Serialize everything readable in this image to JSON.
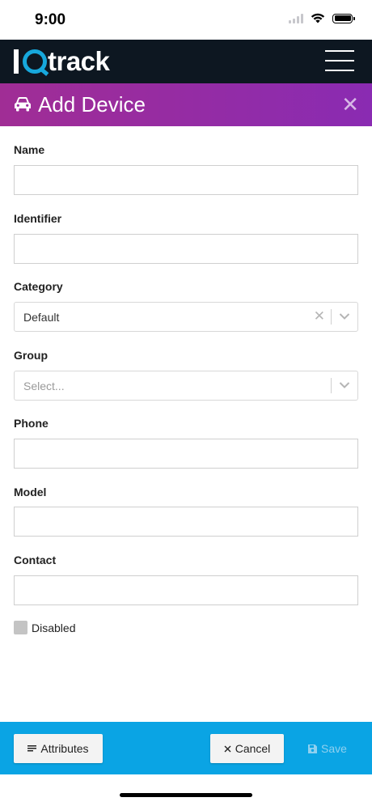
{
  "status_bar": {
    "time": "9:00"
  },
  "app": {
    "logo_text": "IQtrack",
    "logo_word": "track"
  },
  "dialog": {
    "title": "Add Device",
    "close_symbol": "✕"
  },
  "form": {
    "name": {
      "label": "Name",
      "value": ""
    },
    "identifier": {
      "label": "Identifier",
      "value": ""
    },
    "category": {
      "label": "Category",
      "selected": "Default"
    },
    "group": {
      "label": "Group",
      "placeholder": "Select..."
    },
    "phone": {
      "label": "Phone",
      "value": ""
    },
    "model": {
      "label": "Model",
      "value": ""
    },
    "contact": {
      "label": "Contact",
      "value": ""
    },
    "disabled": {
      "label": "Disabled",
      "checked": false
    }
  },
  "toolbar": {
    "attributes_label": "Attributes",
    "cancel_label": "Cancel",
    "save_label": "Save"
  },
  "colors": {
    "appbar": "#0d1721",
    "title_gradient_start": "#a02d95",
    "title_gradient_end": "#8a2bb2",
    "toolbar": "#0aa4e4",
    "logo_accent": "#17a8dc"
  }
}
